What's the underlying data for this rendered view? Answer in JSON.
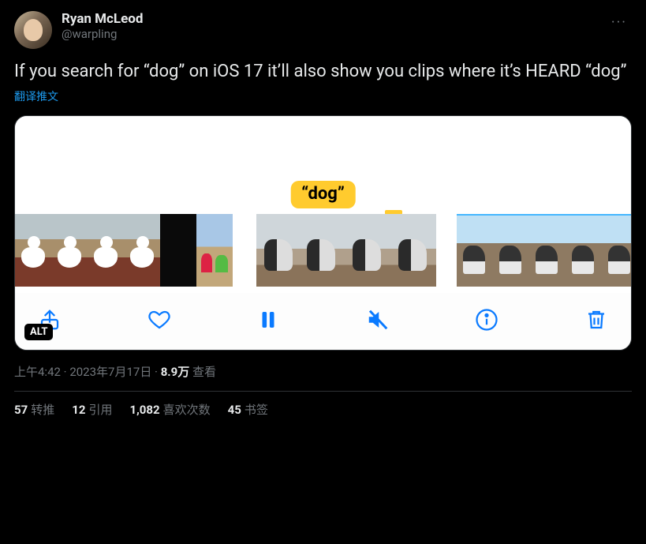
{
  "author": {
    "display_name": "Ryan McLeod",
    "handle": "@warpling"
  },
  "more_glyph": "···",
  "body_text": "If you search for “dog” on iOS 17 it’ll also show you clips where it’s HEARD “dog”",
  "translate_label": "翻译推文",
  "media": {
    "tag_text": "“dog”",
    "alt_badge": "ALT",
    "toolbar": {
      "share": "share-icon",
      "like": "heart-icon",
      "pause": "pause-icon",
      "mute": "mute-icon",
      "info": "info-icon",
      "delete": "trash-icon"
    }
  },
  "meta": {
    "time": "上午4:42",
    "sep1": " · ",
    "date": "2023年7月17日",
    "sep2": " · ",
    "views_num": "8.9万",
    "views_label": " 查看"
  },
  "stats": {
    "retweets_num": "57",
    "retweets_label": "转推",
    "quotes_num": "12",
    "quotes_label": "引用",
    "likes_num": "1,082",
    "likes_label": "喜欢次数",
    "bookmarks_num": "45",
    "bookmarks_label": "书签"
  }
}
